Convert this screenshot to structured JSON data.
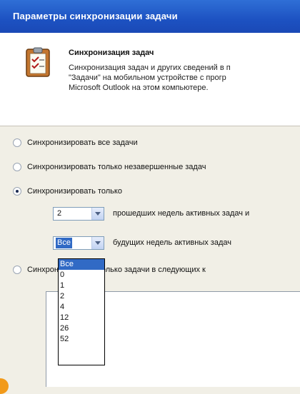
{
  "window": {
    "title": "Параметры синхронизации задачи"
  },
  "header": {
    "title": "Синхронизация задач",
    "description": [
      "Синхронизация задач и других сведений в п",
      "\"Задачи\" на мобильном устройстве с прогр",
      "Microsoft Outlook на этом компьютере."
    ]
  },
  "options": {
    "sync_all": "Синхронизировать все задачи",
    "sync_incomplete": "Синхронизировать только незавершенные задач",
    "sync_only": "Синхронизировать только",
    "sync_categories": "Синхронизировать только задачи в следующих к",
    "selected": "sync_only"
  },
  "past_weeks": {
    "value": "2",
    "label": "прошедших недель активных задач и"
  },
  "future_weeks": {
    "value": "Все",
    "label": "будущих недель активных задач"
  },
  "dropdown": {
    "options": [
      "Все",
      "0",
      "1",
      "2",
      "4",
      "12",
      "26",
      "52"
    ],
    "selected_index": 0
  }
}
